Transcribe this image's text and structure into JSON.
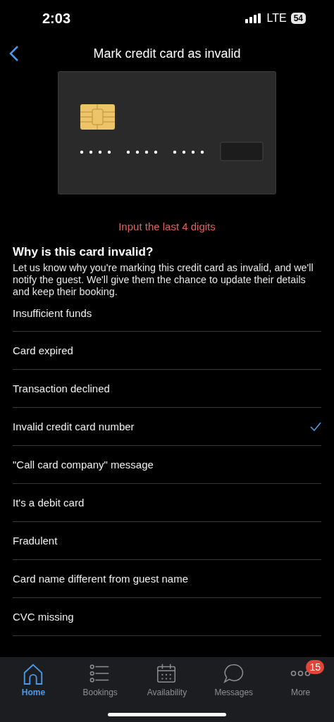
{
  "status_bar": {
    "time": "2:03",
    "network": "LTE",
    "battery": "54"
  },
  "nav": {
    "title": "Mark credit card as invalid"
  },
  "card": {
    "error": "Input the last 4 digits"
  },
  "reasons": {
    "heading": "Why is this card invalid?",
    "description": "Let us know why you're marking this credit card as invalid, and we'll notify the guest. We'll give them the chance to update their details and keep their booking.",
    "items": [
      {
        "label": "Insufficient funds",
        "selected": false
      },
      {
        "label": "Card expired",
        "selected": false
      },
      {
        "label": "Transaction declined",
        "selected": false
      },
      {
        "label": "Invalid credit card number",
        "selected": true
      },
      {
        "label": "\"Call card company\" message",
        "selected": false
      },
      {
        "label": "It's a debit card",
        "selected": false
      },
      {
        "label": "Fradulent",
        "selected": false
      },
      {
        "label": "Card name different from guest name",
        "selected": false
      },
      {
        "label": "CVC missing",
        "selected": false
      }
    ]
  },
  "tab_bar": [
    {
      "label": "Home",
      "kind": "home",
      "selected": true
    },
    {
      "label": "Bookings",
      "kind": "bookings",
      "selected": false
    },
    {
      "label": "Availability",
      "kind": "availability",
      "selected": false
    },
    {
      "label": "Messages",
      "kind": "messages",
      "selected": false
    },
    {
      "label": "More",
      "kind": "more",
      "selected": false,
      "badge": "15"
    }
  ]
}
